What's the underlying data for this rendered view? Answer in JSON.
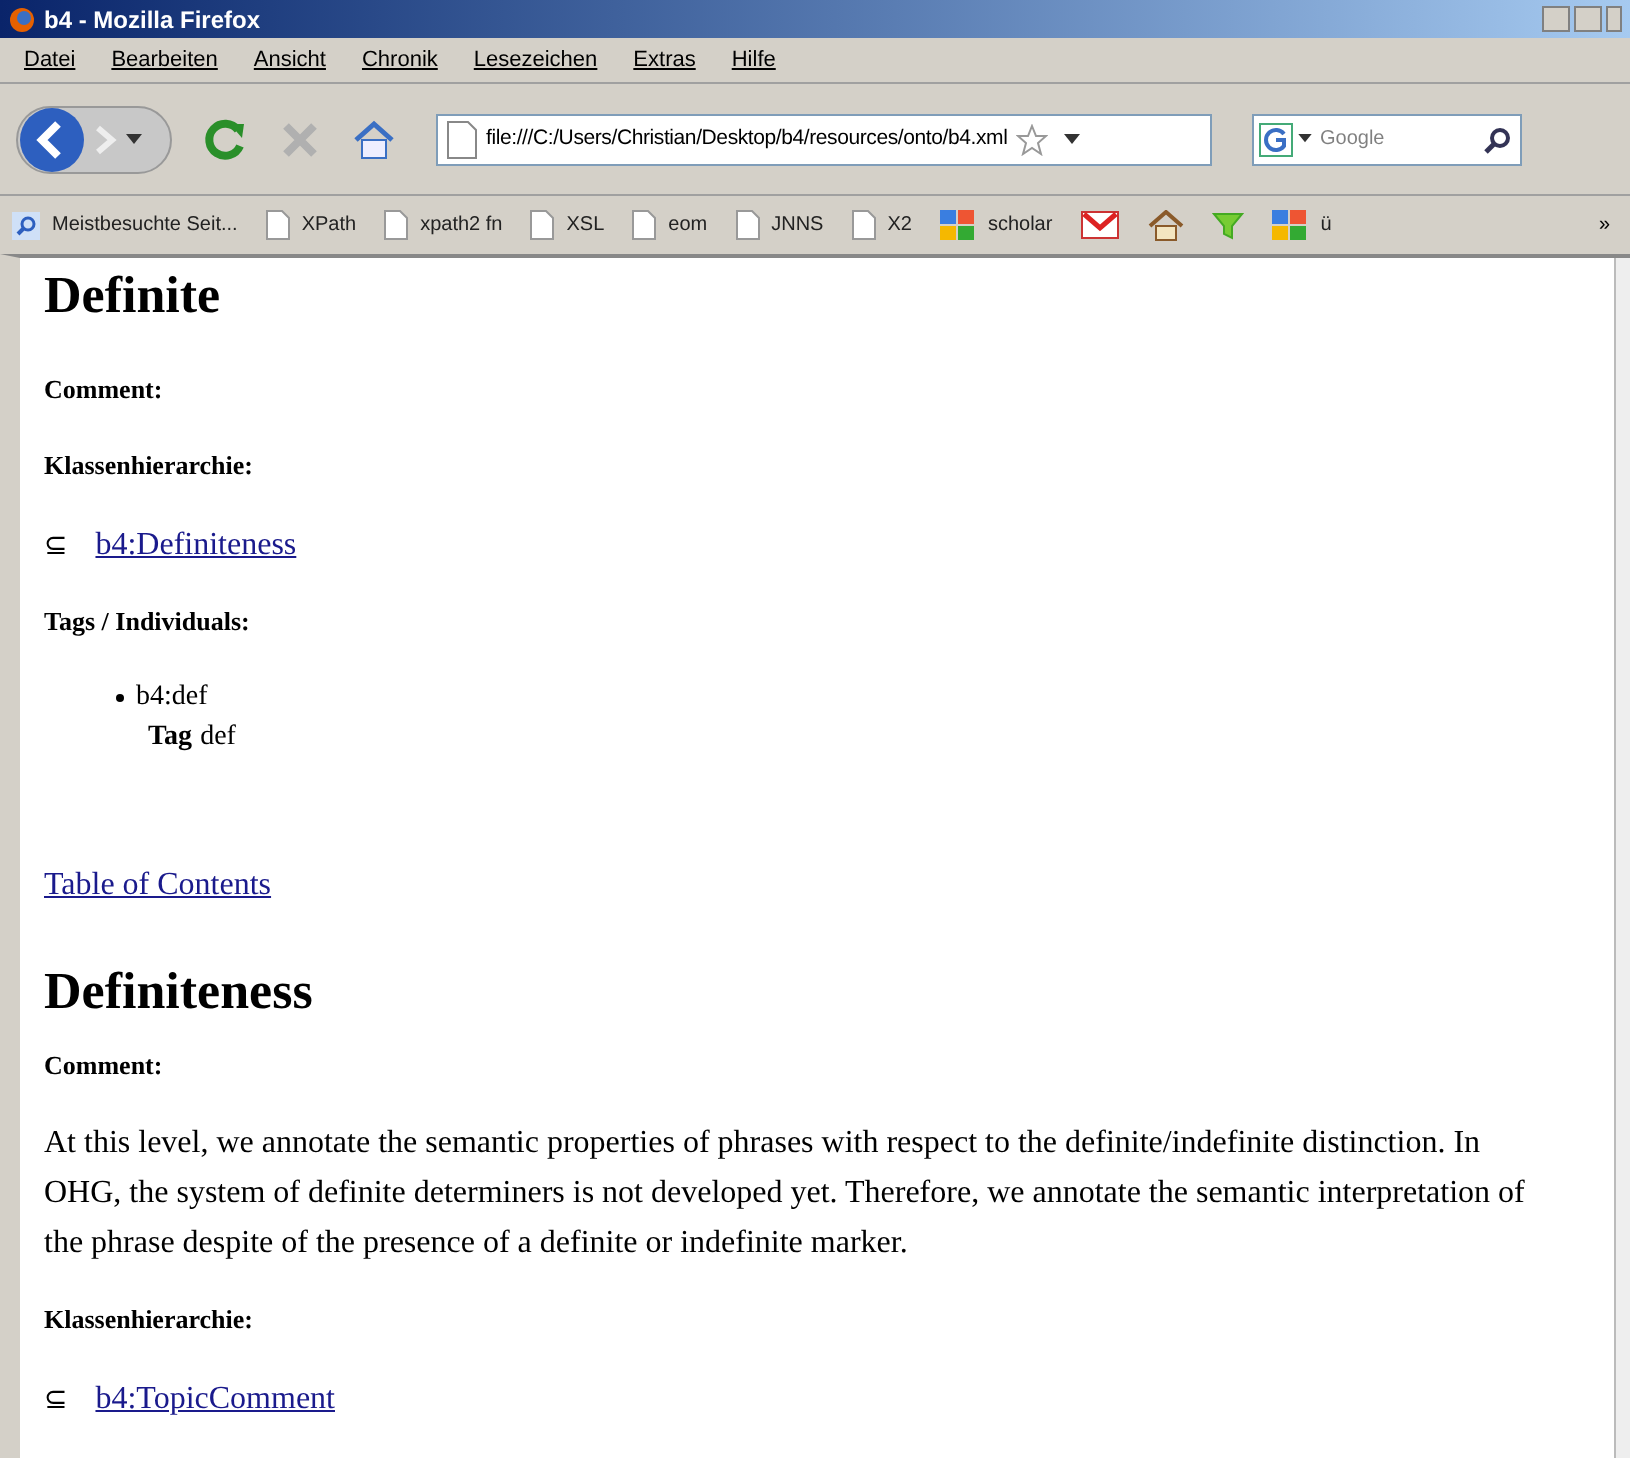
{
  "window": {
    "title": "b4 - Mozilla Firefox"
  },
  "menu": [
    "Datei",
    "Bearbeiten",
    "Ansicht",
    "Chronik",
    "Lesezeichen",
    "Extras",
    "Hilfe"
  ],
  "toolbar": {
    "url": "file:///C:/Users/Christian/Desktop/b4/resources/onto/b4.xml",
    "search_placeholder": "Google"
  },
  "bookmarks": [
    {
      "kind": "smart",
      "label": "Meistbesuchte Seit..."
    },
    {
      "kind": "page",
      "label": "XPath"
    },
    {
      "kind": "page",
      "label": "xpath2 fn"
    },
    {
      "kind": "page",
      "label": "XSL"
    },
    {
      "kind": "page",
      "label": "eom"
    },
    {
      "kind": "page",
      "label": "JNNS"
    },
    {
      "kind": "page",
      "label": "X2"
    },
    {
      "kind": "colorful",
      "label": "scholar"
    },
    {
      "kind": "mail"
    },
    {
      "kind": "home"
    },
    {
      "kind": "funnel"
    },
    {
      "kind": "colorful",
      "label": "ü"
    }
  ],
  "bookmarks_overflow": "»",
  "content": [
    {
      "kind": "heading",
      "text": "Definite"
    },
    {
      "kind": "label",
      "text": "Comment:"
    },
    {
      "kind": "label",
      "text": "Klassenhierarchie:"
    },
    {
      "kind": "superclass",
      "symbol": "⊆",
      "link": "b4:Definiteness"
    },
    {
      "kind": "label",
      "text": "Tags / Individuals:"
    },
    {
      "kind": "individuals",
      "items": [
        {
          "name": "b4:def",
          "tag_label": "Tag",
          "tag": "def"
        }
      ]
    },
    {
      "kind": "link",
      "text": "Table of Contents"
    },
    {
      "kind": "heading",
      "text": "Definiteness"
    },
    {
      "kind": "label",
      "text": "Comment:"
    },
    {
      "kind": "paragraph",
      "text": "At this level, we annotate the semantic properties of phrases with respect to the definite/indefinite distinction. In OHG, the system of definite determiners is not developed yet. Therefore, we annotate the semantic interpretation of the phrase despite of the presence of a definite or indefinite marker."
    },
    {
      "kind": "label",
      "text": "Klassenhierarchie:"
    },
    {
      "kind": "superclass",
      "symbol": "⊆",
      "link": "b4:TopicComment"
    }
  ]
}
